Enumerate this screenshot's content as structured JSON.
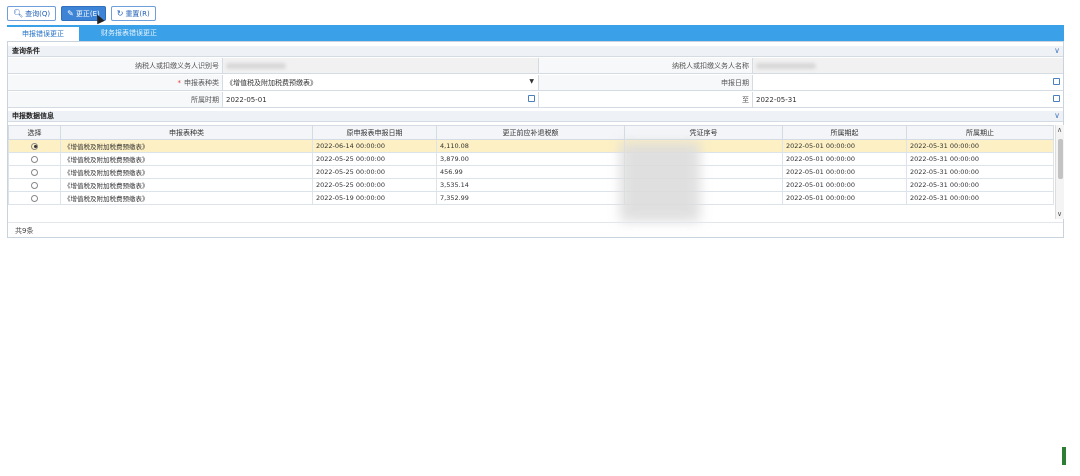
{
  "toolbar": {
    "query_label": "查询(Q)",
    "correct_label": "更正(E)",
    "reset_label": "重置(R)"
  },
  "tabs": [
    {
      "label": "申报错误更正"
    },
    {
      "label": "财务报表错误更正"
    }
  ],
  "query_section": {
    "title": "查询条件",
    "taxpayer_id_label": "纳税人或扣缴义务人识别号",
    "taxpayer_name_label": "纳税人或扣缴义务人名称",
    "report_type_label": "申报表种类",
    "report_type_value": "《增值税及附加税费预缴表》",
    "report_date_label": "申报日期",
    "period_label": "所属时期",
    "period_start": "2022-05-01",
    "to_label": "至",
    "period_end": "2022-05-31"
  },
  "data_section": {
    "title": "申报数据信息",
    "columns": [
      "选择",
      "申报表种类",
      "原申报表申报日期",
      "更正前应补退税额",
      "凭证序号",
      "所属期起",
      "所属期止"
    ],
    "rows": [
      {
        "type": "《增值税及附加税费预缴表》",
        "date": "2022-06-14 00:00:00",
        "amount": "4,110.08",
        "start": "2022-05-01 00:00:00",
        "end": "2022-05-31 00:00:00",
        "selected": true
      },
      {
        "type": "《增值税及附加税费预缴表》",
        "date": "2022-05-25 00:00:00",
        "amount": "3,879.00",
        "start": "2022-05-01 00:00:00",
        "end": "2022-05-31 00:00:00",
        "selected": false
      },
      {
        "type": "《增值税及附加税费预缴表》",
        "date": "2022-05-25 00:00:00",
        "amount": "456.99",
        "start": "2022-05-01 00:00:00",
        "end": "2022-05-31 00:00:00",
        "selected": false
      },
      {
        "type": "《增值税及附加税费预缴表》",
        "date": "2022-05-25 00:00:00",
        "amount": "3,535.14",
        "start": "2022-05-01 00:00:00",
        "end": "2022-05-31 00:00:00",
        "selected": false
      },
      {
        "type": "《增值税及附加税费预缴表》",
        "date": "2022-05-19 00:00:00",
        "amount": "7,352.99",
        "start": "2022-05-01 00:00:00",
        "end": "2022-05-31 00:00:00",
        "selected": false
      }
    ],
    "footer": "共9条"
  },
  "colors": {
    "tab_bar": "#3aa0e8",
    "primary_button": "#3d84d6",
    "selected_row": "#fdf0c4"
  }
}
